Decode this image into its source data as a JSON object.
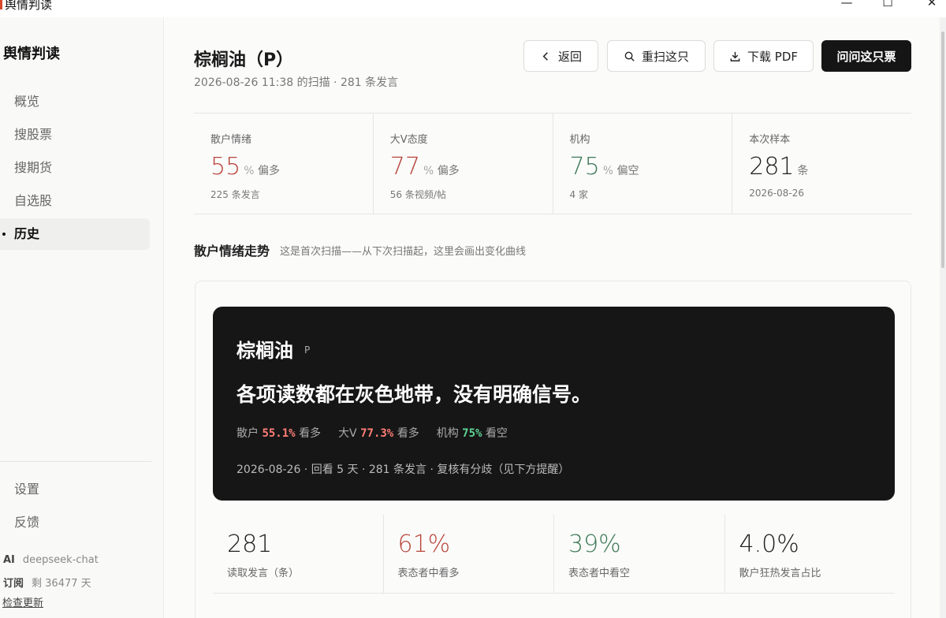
{
  "window": {
    "title": "舆情判读"
  },
  "sidebar": {
    "brand": "舆情判读",
    "items": [
      {
        "label": "概览"
      },
      {
        "label": "搜股票"
      },
      {
        "label": "搜期货"
      },
      {
        "label": "自选股"
      },
      {
        "label": "历史"
      }
    ],
    "bottom_items": [
      {
        "label": "设置"
      },
      {
        "label": "反馈"
      }
    ],
    "meta": {
      "ai_key": "AI",
      "ai_value": "deepseek-chat",
      "sub_key": "订阅",
      "sub_value": "剩 36477 天"
    },
    "check_update": "检查更新"
  },
  "header": {
    "title": "棕榈油（P）",
    "subtitle": "2026-08-26 11:38 的扫描 · 281 条发言",
    "buttons": {
      "back": "返回",
      "rescan": "重扫这只",
      "pdf": "下载 PDF",
      "ask": "问问这只票"
    }
  },
  "stats": [
    {
      "label": "散户情绪",
      "value": "55",
      "unit": "% 偏多",
      "note": "225 条发言",
      "color": "#b9473d"
    },
    {
      "label": "大V态度",
      "value": "77",
      "unit": "% 偏多",
      "note": "56 条视频/帖",
      "color": "#b9473d"
    },
    {
      "label": "机构",
      "value": "75",
      "unit": "% 偏空",
      "note": "4 家",
      "color": "#3f7a57"
    },
    {
      "label": "本次样本",
      "value": "281",
      "unit": "条",
      "note": "2026-08-26",
      "color": "#1f1f1f"
    }
  ],
  "trend": {
    "title": "散户情绪走势",
    "note": "这是首次扫描——从下次扫描起，这里会画出变化曲线"
  },
  "summary_card": {
    "name": "棕榈油",
    "code": "P",
    "headline": "各项读数都在灰色地带，没有明确信号。",
    "readings": [
      {
        "label": "散户",
        "value": "55.1%",
        "tail": "看多",
        "color": "#ff7e77"
      },
      {
        "label": "大V",
        "value": "77.3%",
        "tail": "看多",
        "color": "#ff7e77"
      },
      {
        "label": "机构",
        "value": "75%",
        "tail": "看空",
        "color": "#60d394"
      }
    ],
    "footer": "2026-08-26 · 回看 5 天 · 281 条发言 · 复核有分歧（见下方提醒）"
  },
  "kpis": [
    {
      "value": "281",
      "caption": "读取发言（条）",
      "color": "#1f1f1f"
    },
    {
      "value": "61%",
      "caption": "表态者中看多",
      "color": "#b9473d"
    },
    {
      "value": "39%",
      "caption": "表态者中看空",
      "color": "#3f7a57"
    },
    {
      "value": "4.0%",
      "caption": "散户狂热发言占比",
      "color": "#1f1f1f"
    }
  ]
}
